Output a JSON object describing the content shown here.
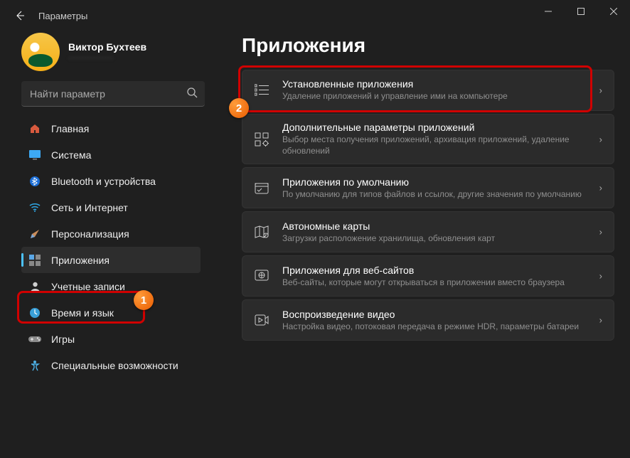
{
  "app_title": "Параметры",
  "profile": {
    "name": "Виктор Бухтеев",
    "email_masked": "················"
  },
  "search": {
    "placeholder": "Найти параметр"
  },
  "page_heading": "Приложения",
  "annotations": {
    "badge1": "1",
    "badge2": "2"
  },
  "nav": [
    {
      "label": "Главная",
      "icon": "home-icon"
    },
    {
      "label": "Система",
      "icon": "system-icon"
    },
    {
      "label": "Bluetooth и устройства",
      "icon": "bluetooth-icon"
    },
    {
      "label": "Сеть и Интернет",
      "icon": "network-icon"
    },
    {
      "label": "Персонализация",
      "icon": "personalization-icon"
    },
    {
      "label": "Приложения",
      "icon": "apps-icon",
      "selected": true
    },
    {
      "label": "Учетные записи",
      "icon": "accounts-icon"
    },
    {
      "label": "Время и язык",
      "icon": "time-lang-icon"
    },
    {
      "label": "Игры",
      "icon": "gaming-icon"
    },
    {
      "label": "Специальные возможности",
      "icon": "accessibility-icon"
    }
  ],
  "cards": [
    {
      "title": "Установленные приложения",
      "desc": "Удаление приложений и управление ими на компьютере",
      "icon": "installed-apps-icon"
    },
    {
      "title": "Дополнительные параметры приложений",
      "desc": "Выбор места получения приложений, архивация приложений, удаление обновлений",
      "icon": "advanced-apps-icon"
    },
    {
      "title": "Приложения по умолчанию",
      "desc": "По умолчанию для типов файлов и ссылок, другие значения по умолчанию",
      "icon": "default-apps-icon"
    },
    {
      "title": "Автономные карты",
      "desc": "Загрузки расположение хранилища, обновления карт",
      "icon": "offline-maps-icon"
    },
    {
      "title": "Приложения для веб-сайтов",
      "desc": "Веб-сайты, которые могут открываться в приложении вместо браузера",
      "icon": "web-apps-icon"
    },
    {
      "title": "Воспроизведение видео",
      "desc": "Настройка видео, потоковая передача в режиме HDR, параметры батареи",
      "icon": "video-playback-icon"
    }
  ]
}
